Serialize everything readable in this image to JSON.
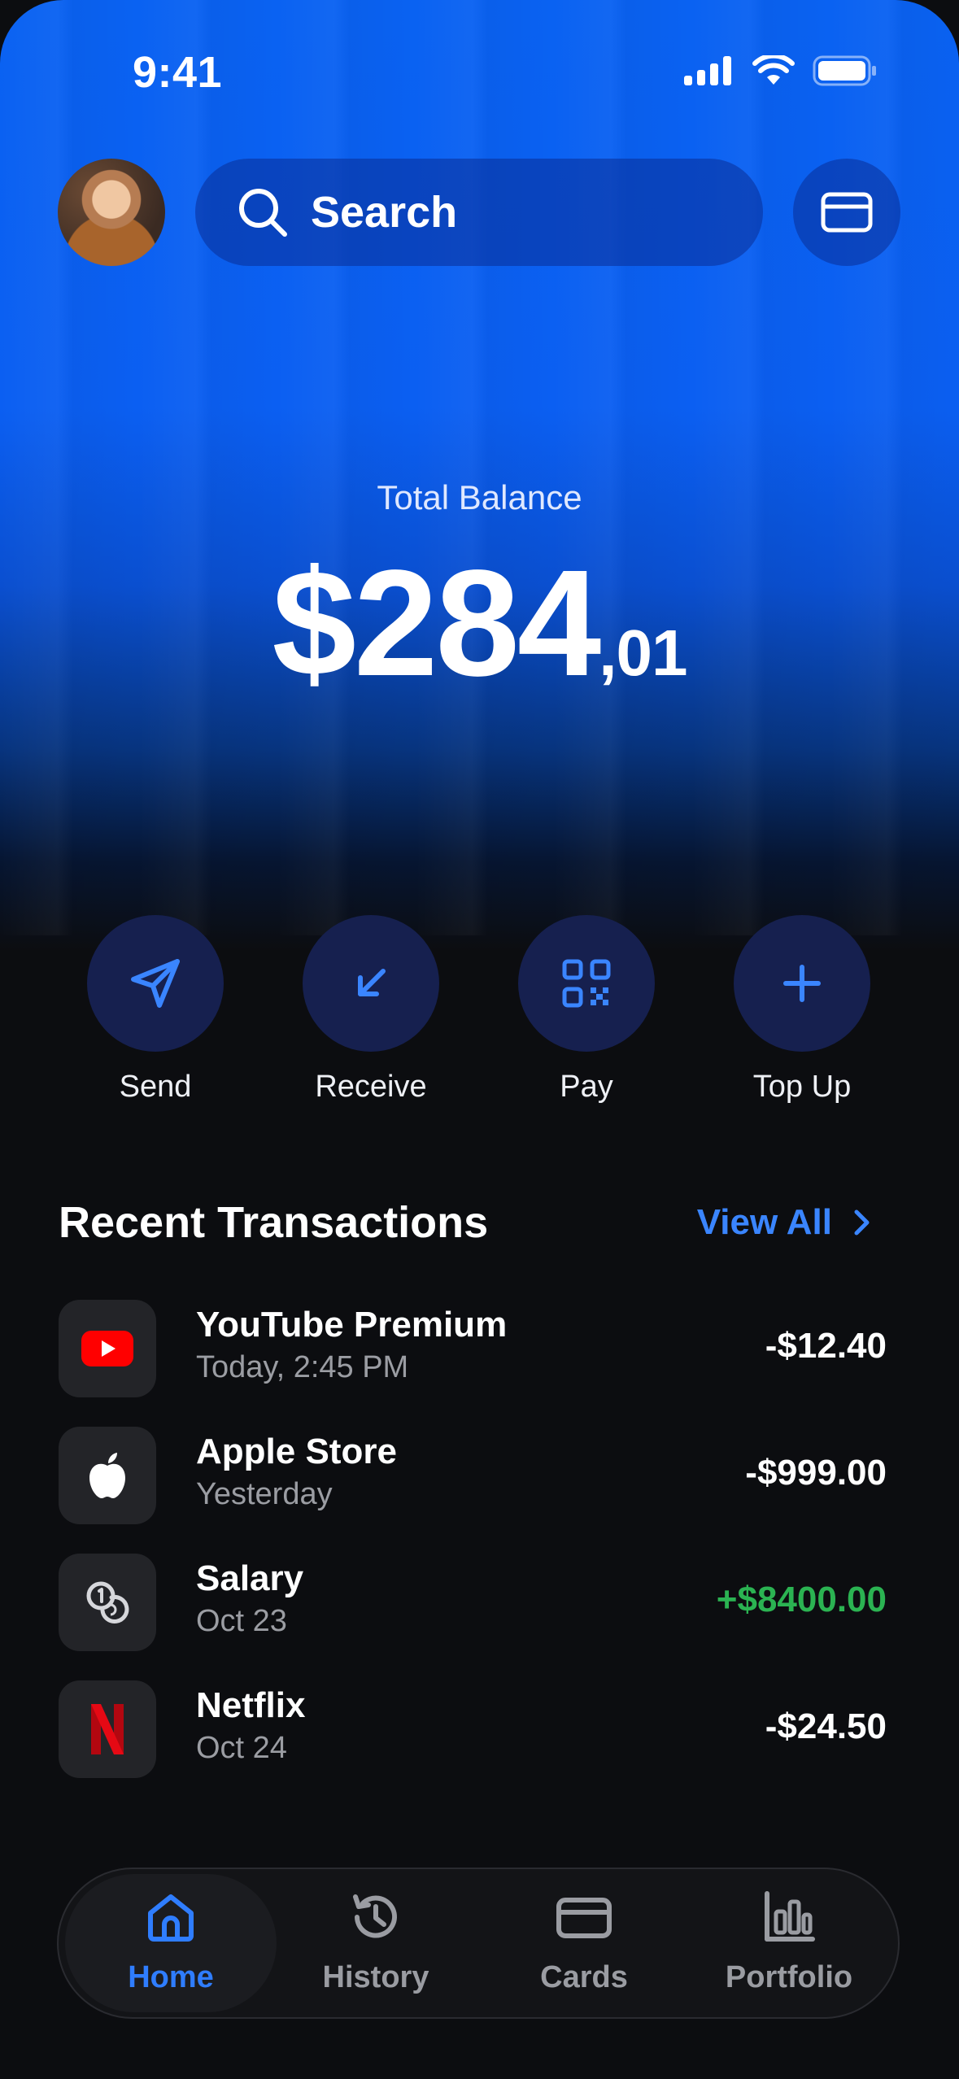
{
  "status_bar": {
    "time": "9:41"
  },
  "header": {
    "search_placeholder": "Search"
  },
  "balance": {
    "label": "Total Balance",
    "main": "$284",
    "cents": ",01"
  },
  "actions": [
    {
      "label": "Send",
      "icon": "send-icon"
    },
    {
      "label": "Receive",
      "icon": "receive-arrow-icon"
    },
    {
      "label": "Pay",
      "icon": "qr-code-icon"
    },
    {
      "label": "Top Up",
      "icon": "plus-icon"
    }
  ],
  "recent": {
    "title": "Recent Transactions",
    "view_all": "View All",
    "items": [
      {
        "name": "YouTube Premium",
        "sub": "Today, 2:45 PM",
        "amount": "-$12.40",
        "icon": "youtube-icon"
      },
      {
        "name": "Apple Store",
        "sub": "Yesterday",
        "amount": "-$999.00",
        "icon": "apple-icon"
      },
      {
        "name": "Salary",
        "sub": "Oct 23",
        "amount": "+$8400.00",
        "icon": "coins-icon"
      },
      {
        "name": "Netflix",
        "sub": "Oct 24",
        "amount": "-$24.50",
        "icon": "netflix-icon"
      }
    ]
  },
  "tabs": [
    {
      "label": "Home",
      "icon": "home-icon",
      "active": true
    },
    {
      "label": "History",
      "icon": "history-icon"
    },
    {
      "label": "Cards",
      "icon": "card-icon"
    },
    {
      "label": "Portfolio",
      "icon": "bar-chart-icon"
    }
  ],
  "colors": {
    "accent": "#2f7dff",
    "positive": "#2bb352",
    "background": "#0c0d10",
    "hero_blue": "#0a62f2"
  }
}
